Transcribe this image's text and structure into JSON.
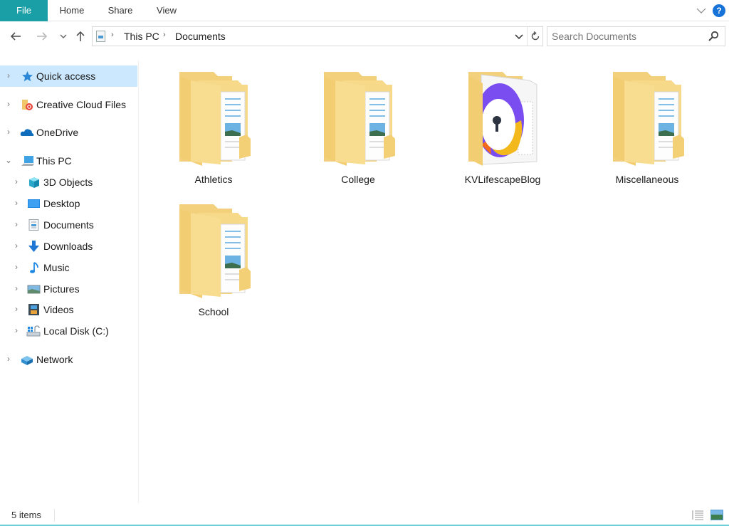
{
  "ribbon": {
    "tabs": [
      {
        "label": "File",
        "active": true
      },
      {
        "label": "Home"
      },
      {
        "label": "Share"
      },
      {
        "label": "View"
      }
    ],
    "help_label": "?",
    "accent_color": "#1b9fa6"
  },
  "navigation": {
    "back_icon": "arrow-left-icon",
    "forward_icon": "arrow-right-icon",
    "recent_icon": "chevron-down-icon",
    "up_icon": "arrow-up-icon"
  },
  "address": {
    "breadcrumb": [
      "This PC",
      "Documents"
    ],
    "separator": "›"
  },
  "search": {
    "placeholder": "Search Documents",
    "value": ""
  },
  "sidebar": {
    "items": [
      {
        "label": "Quick access",
        "icon": "star-icon",
        "selected": true
      },
      {
        "label": "Creative Cloud Files",
        "icon": "creative-cloud-folder-icon"
      },
      {
        "label": "OneDrive",
        "icon": "cloud-icon"
      },
      {
        "label": "This PC",
        "icon": "computer-icon",
        "expanded": true
      },
      {
        "label": "3D Objects",
        "icon": "cube-icon"
      },
      {
        "label": "Desktop",
        "icon": "desktop-icon"
      },
      {
        "label": "Documents",
        "icon": "document-icon"
      },
      {
        "label": "Downloads",
        "icon": "download-arrow-icon"
      },
      {
        "label": "Music",
        "icon": "music-note-icon"
      },
      {
        "label": "Pictures",
        "icon": "picture-icon"
      },
      {
        "label": "Videos",
        "icon": "film-icon"
      },
      {
        "label": "Local Disk (C:)",
        "icon": "drive-icon"
      },
      {
        "label": "Network",
        "icon": "network-icon"
      }
    ]
  },
  "content": {
    "folders": [
      {
        "name": "Athletics",
        "type": "documents-folder"
      },
      {
        "name": "College",
        "type": "documents-folder"
      },
      {
        "name": "KVLifescapeBlog",
        "type": "app-folder"
      },
      {
        "name": "Miscellaneous",
        "type": "documents-folder"
      },
      {
        "name": "School",
        "type": "documents-folder"
      }
    ]
  },
  "status": {
    "item_count": "5 items"
  }
}
